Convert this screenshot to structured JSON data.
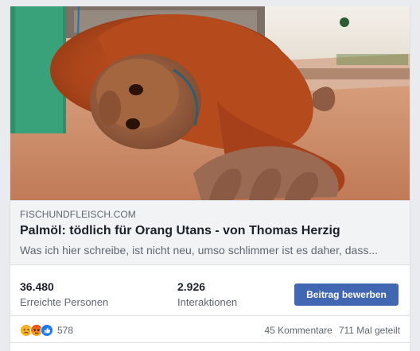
{
  "link_preview": {
    "image_alt": "Orang-Utan liegt auf dem Boden",
    "domain": "FISCHUNDFLEISCH.COM",
    "headline": "Palmöl: tödlich für Orang Utans - von Thomas Herzig",
    "snippet": "Was ich hier schreibe, ist nicht neu, umso schlimmer ist es daher, dass..."
  },
  "stats": {
    "reach_value": "36.480",
    "reach_label": "Erreichte Personen",
    "engagement_value": "2.926",
    "engagement_label": "Interaktionen",
    "boost_label": "Beitrag bewerben"
  },
  "reactions": {
    "icons": [
      "sad-reaction-icon",
      "angry-reaction-icon",
      "like-reaction-icon"
    ],
    "count": "578",
    "comments": "45 Kommentare",
    "shares": "711 Mal geteilt"
  },
  "colors": {
    "accent": "#4267b2",
    "like_blue": "#2078f4",
    "sad_yellow": "#f7b125",
    "angry_red": "#e9710f"
  }
}
